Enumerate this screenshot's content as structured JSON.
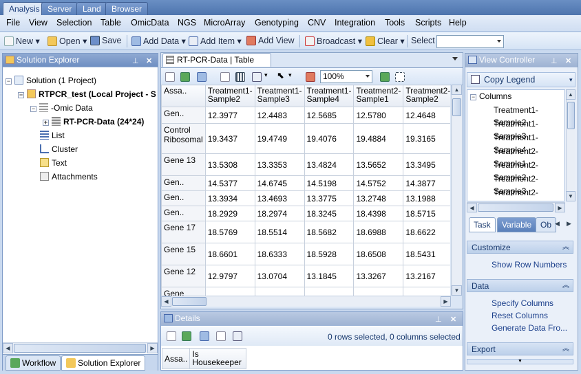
{
  "top_tabs": [
    "Analysis",
    "Server",
    "Land",
    "Browser"
  ],
  "menu": [
    "File",
    "View",
    "Selection",
    "Table",
    "OmicData",
    "NGS",
    "MicroArray",
    "Genotyping",
    "CNV",
    "Integration",
    "Tools",
    "Scripts",
    "Help"
  ],
  "toolbar": {
    "new": "New",
    "open": "Open",
    "save": "Save",
    "add_data": "Add Data",
    "add_item": "Add Item",
    "add_view": "Add View",
    "broadcast": "Broadcast",
    "clear": "Clear",
    "select": "Select",
    "select_value": ""
  },
  "solution_explorer": {
    "title": "Solution Explorer",
    "root": "Solution (1 Project)",
    "project": "RTPCR_test (Local Project - S",
    "omic": "-Omic Data",
    "dataset": "RT-PCR-Data (24*24)",
    "list": "List",
    "cluster": "Cluster",
    "text": "Text",
    "attachments": "Attachments"
  },
  "bottom_tabs": {
    "workflow": "Workflow",
    "solution": "Solution Explorer"
  },
  "doc": {
    "tab": "RT-PCR-Data | Table",
    "zoom": "100%"
  },
  "table": {
    "columns": [
      "Assa..",
      "Treatment1-Sample2",
      "Treatment1-Sample3",
      "Treatment1-Sample4",
      "Treatment2-Sample1",
      "Treatment2-Sample2"
    ],
    "rows": [
      [
        "Gen..",
        "12.3977",
        "12.4483",
        "12.5685",
        "12.5780",
        "12.4648"
      ],
      [
        "Control Ribosomal",
        "19.3437",
        "19.4749",
        "19.4076",
        "19.4884",
        "19.3165"
      ],
      [
        "Gene 13",
        "13.5308",
        "13.3353",
        "13.4824",
        "13.5652",
        "13.3495"
      ],
      [
        "Gen..",
        "14.5377",
        "14.6745",
        "14.5198",
        "14.5752",
        "14.3877"
      ],
      [
        "Gen..",
        "13.3934",
        "13.4693",
        "13.3775",
        "13.2748",
        "13.1988"
      ],
      [
        "Gen..",
        "18.2929",
        "18.2974",
        "18.3245",
        "18.4398",
        "18.5715"
      ],
      [
        "Gene 17",
        "18.5769",
        "18.5514",
        "18.5682",
        "18.6988",
        "18.6622"
      ],
      [
        "Gene 15",
        "18.6601",
        "18.6333",
        "18.5928",
        "18.6508",
        "18.5431"
      ],
      [
        "Gene 12",
        "12.9797",
        "13.0704",
        "13.1845",
        "13.3267",
        "13.2167"
      ],
      [
        "Gene",
        "",
        "",
        "",
        "",
        ""
      ]
    ]
  },
  "details": {
    "title": "Details",
    "status": "0 rows selected, 0 columns selected",
    "col1": "Assa..",
    "col2": "Is Housekeeper"
  },
  "view_controller": {
    "title": "View Controller",
    "copy_legend": "Copy Legend",
    "columns_label": "Columns",
    "columns": [
      "Treatment1-Sample2",
      "Treatment1-Sample3",
      "Treatment1-Sample4",
      "Treatment2-Sample1",
      "Treatment2-Sample2",
      "Treatment2-Sample3",
      "Treatment2-Sample4",
      "Treatment3-Sample1"
    ],
    "tabs": [
      "Task",
      "Variable",
      "Ob"
    ],
    "customize": "Customize",
    "show_row_numbers": "Show Row Numbers",
    "data": "Data",
    "specify_columns": "Specify Columns",
    "reset_columns": "Reset Columns",
    "generate_data": "Generate Data Fro...",
    "export": "Export"
  }
}
